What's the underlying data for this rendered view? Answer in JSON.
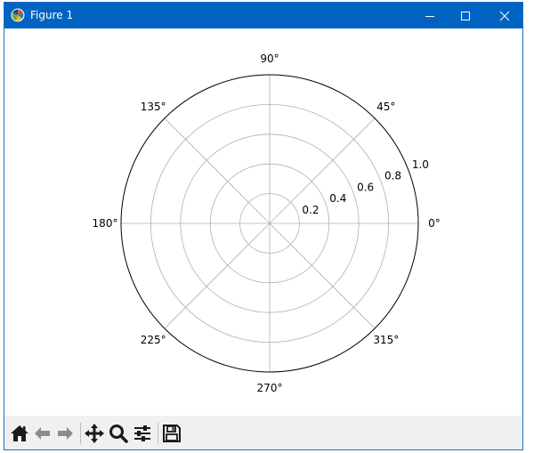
{
  "window": {
    "title": "Figure 1",
    "icon": "matplotlib-icon",
    "controls": [
      "minimize-icon",
      "maximize-icon",
      "close-icon"
    ]
  },
  "toolbar": {
    "buttons": [
      "home-icon",
      "back-arrow-icon",
      "forward-arrow-icon",
      "pan-move-icon",
      "zoom-magnifier-icon",
      "configure-subplots-icon",
      "save-floppy-icon"
    ]
  },
  "colors": {
    "titlebar": "#0063c1",
    "toolbar": "#f0f0f0",
    "grid": "#b0b0b0",
    "spine": "#000000"
  },
  "chart_data": {
    "type": "polar",
    "title": "",
    "series": [],
    "theta_ticks": [
      {
        "deg": 0,
        "label": "0°"
      },
      {
        "deg": 45,
        "label": "45°"
      },
      {
        "deg": 90,
        "label": "90°"
      },
      {
        "deg": 135,
        "label": "135°"
      },
      {
        "deg": 180,
        "label": "180°"
      },
      {
        "deg": 225,
        "label": "225°"
      },
      {
        "deg": 270,
        "label": "270°"
      },
      {
        "deg": 315,
        "label": "315°"
      }
    ],
    "r_ticks": [
      {
        "value": 0.2,
        "label": "0.2"
      },
      {
        "value": 0.4,
        "label": "0.4"
      },
      {
        "value": 0.6,
        "label": "0.6"
      },
      {
        "value": 0.8,
        "label": "0.8"
      },
      {
        "value": 1.0,
        "label": "1.0"
      }
    ],
    "rlim": [
      0,
      1.0
    ],
    "grid": true
  }
}
